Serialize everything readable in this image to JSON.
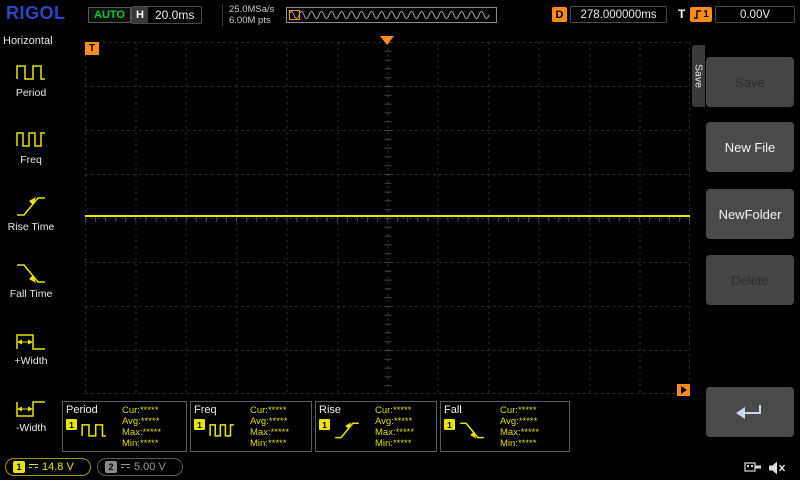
{
  "colors": {
    "trace_yellow": "#e8e500",
    "marker_orange": "#ff8c1a",
    "run_green": "#00cc33",
    "logo_blue": "#2946c8"
  },
  "top_bar": {
    "logo": "RIGOL",
    "run_state": "AUTO",
    "horizontal_label": "H",
    "timebase": "20.0ms",
    "sample_rate": "25.0MSa/s",
    "memory_depth": "6.00M pts",
    "delay_label": "D",
    "delay_value": "278.000000ms",
    "trigger_label": "T",
    "trigger_source": "1",
    "trigger_level": "0.00V"
  },
  "left_menu": {
    "title": "Horizontal",
    "items": [
      {
        "label": "Period",
        "icon": "period-icon"
      },
      {
        "label": "Freq",
        "icon": "freq-icon"
      },
      {
        "label": "Rise Time",
        "icon": "rise-time-icon"
      },
      {
        "label": "Fall Time",
        "icon": "fall-time-icon"
      },
      {
        "label": "+Width",
        "icon": "plus-width-icon"
      },
      {
        "label": "-Width",
        "icon": "minus-width-icon"
      }
    ]
  },
  "graticule": {
    "trigger_corner_label": "T"
  },
  "right_menu": {
    "tab_title": "Save",
    "buttons": [
      {
        "label": "Save",
        "enabled": false
      },
      {
        "label": "New File",
        "enabled": true
      },
      {
        "label": "NewFolder",
        "enabled": true
      },
      {
        "label": "Delete",
        "enabled": false
      }
    ],
    "back_icon": "return-arrow-icon"
  },
  "measurements": {
    "items": [
      {
        "name": "Period",
        "channel": "1",
        "icon": "period-icon",
        "cur": "Cur:*****",
        "avg": "Avg:*****",
        "max": "Max:*****",
        "min": "Min:*****"
      },
      {
        "name": "Freq",
        "channel": "1",
        "icon": "freq-icon",
        "cur": "Cur:*****",
        "avg": "Avg:*****",
        "max": "Max:*****",
        "min": "Min:*****"
      },
      {
        "name": "Rise",
        "channel": "1",
        "icon": "rise-time-icon",
        "cur": "Cur:*****",
        "avg": "Avg:*****",
        "max": "Max:*****",
        "min": "Min:*****"
      },
      {
        "name": "Fall",
        "channel": "1",
        "icon": "fall-time-icon",
        "cur": "Cur:*****",
        "avg": "Avg:*****",
        "max": "Max:*****",
        "min": "Min:*****"
      }
    ]
  },
  "status_bar": {
    "channel1": {
      "number": "1",
      "scale": "14.8 V"
    },
    "channel2": {
      "number": "2",
      "scale": "5.00 V"
    },
    "tray_icons": [
      "usb-icon",
      "speaker-muted-icon"
    ]
  }
}
